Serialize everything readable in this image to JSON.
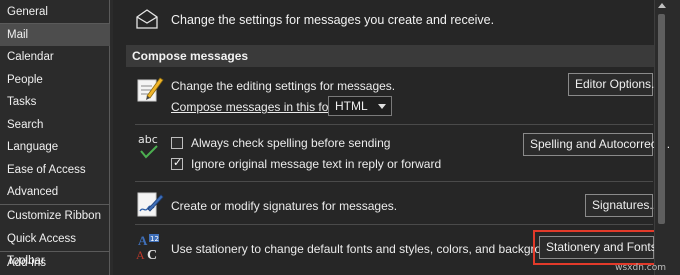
{
  "sidebar": {
    "items": [
      {
        "label": "General",
        "active": false
      },
      {
        "label": "Mail",
        "active": true
      },
      {
        "label": "Calendar",
        "active": false
      },
      {
        "label": "People",
        "active": false
      },
      {
        "label": "Tasks",
        "active": false
      },
      {
        "label": "Search",
        "active": false
      },
      {
        "label": "Language",
        "active": false
      },
      {
        "label": "Ease of Access",
        "active": false
      },
      {
        "label": "Advanced",
        "active": false
      },
      {
        "label": "Customize Ribbon",
        "active": false
      },
      {
        "label": "Quick Access Toolbar",
        "active": false
      },
      {
        "label": "Add-ins",
        "active": false
      }
    ]
  },
  "main": {
    "intro_text": "Change the settings for messages you create and receive.",
    "section_title": "Compose messages",
    "editing": {
      "text": "Change the editing settings for messages.",
      "editor_options_button": "Editor Options...",
      "compose_format_label": "Compose messages in this format:",
      "compose_format_value": "HTML"
    },
    "spelling": {
      "icon_text": "abc",
      "always_check_label": "Always check spelling before sending",
      "always_check_checked": false,
      "ignore_original_label": "Ignore original message text in reply or forward",
      "ignore_original_checked": true,
      "spelling_button": "Spelling and Autocorrect..."
    },
    "signatures": {
      "text": "Create or modify signatures for messages.",
      "button": "Signatures..."
    },
    "stationery": {
      "text": "Use stationery to change default fonts and styles, colors, and backgrounds.",
      "button": "Stationery and Fonts..."
    }
  },
  "watermark": "wsxdn.com",
  "colors": {
    "highlight_box": "#e23a2a",
    "checkmark_green": "#4caf50"
  }
}
